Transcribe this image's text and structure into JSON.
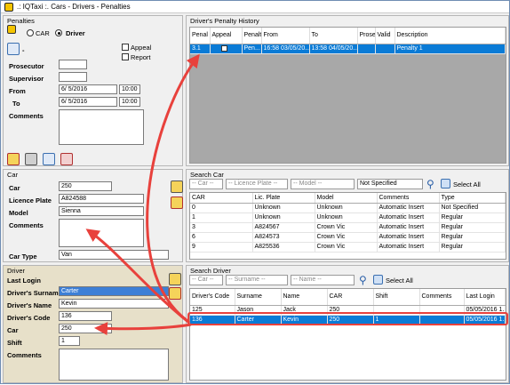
{
  "window": {
    "title": ".: IQTaxi :. Cars - Drivers - Penalties"
  },
  "penalties": {
    "group_title": "Penalties",
    "car_label": "CAR",
    "driver_label": "Driver",
    "appeal_label": "Appeal",
    "report_label": "Report",
    "prosecutor_label": "Prosecutor",
    "supervisor_label": "Supervisor",
    "from_label": "From",
    "to_label": "To",
    "from_date": "6/ 5/2016",
    "from_time": "10:00",
    "to_date": "6/ 5/2016",
    "to_time": "10:00",
    "comments_label": "Comments"
  },
  "car": {
    "group_title": "Car",
    "car_label": "Car",
    "car_value": "250",
    "plate_label": "Licence Plate",
    "plate_value": "A824588",
    "model_label": "Model",
    "model_value": "Sienna",
    "comments_label": "Comments",
    "type_label": "Car Type",
    "type_value": "Van"
  },
  "driver": {
    "group_title": "Driver",
    "last_login_label": "Last Login",
    "surname_label": "Driver's Surname",
    "surname_value": "Carter",
    "name_label": "Driver's Name",
    "name_value": "Kevin",
    "code_label": "Driver's Code",
    "code_value": "136",
    "car_label": "Car",
    "car_value": "250",
    "shift_label": "Shift",
    "shift_value": "1",
    "comments_label": "Comments"
  },
  "history": {
    "group_title": "Driver's Penalty History",
    "columns": [
      "Penal Code",
      "Appeal",
      "Penalt",
      "From",
      "To",
      "Prose",
      "Valid",
      "Description"
    ],
    "rows": [
      [
        "3.1",
        "",
        "Pen...",
        "16:58 03/05/20...",
        "13:58 04/05/20...",
        "",
        "",
        "Penalty 1"
      ]
    ]
  },
  "search_car": {
    "group_title": "Search Car",
    "filter_car": "-- Car --",
    "filter_plate": "-- Licence Plate --",
    "filter_model": "-- Model --",
    "filter_type": "Not Specified",
    "select_all": "Select All",
    "columns": [
      "CAR",
      "Lic. Plate",
      "Model",
      "Comments",
      "Type"
    ],
    "rows": [
      [
        "0",
        "Unknown",
        "Unknown",
        "Automatic Insert",
        "Not Specified"
      ],
      [
        "1",
        "Unknown",
        "Unknown",
        "Automatic Insert",
        "Regular"
      ],
      [
        "3",
        "A824567",
        "Crown Vic",
        "Automatic Insert",
        "Regular"
      ],
      [
        "6",
        "A824573",
        "Crown Vic",
        "Automatic Insert",
        "Regular"
      ],
      [
        "9",
        "A825536",
        "Crown Vic",
        "Automatic Insert",
        "Regular"
      ]
    ]
  },
  "search_driver": {
    "group_title": "Search Driver",
    "filter_car": "-- Car --",
    "filter_surname": "-- Surname --",
    "filter_name": "-- Name --",
    "select_all": "Select All",
    "columns": [
      "Driver's Code",
      "Surname",
      "Name",
      "CAR",
      "Shift",
      "Comments",
      "Last Login"
    ],
    "rows": [
      [
        "125",
        "Jason",
        "Jack",
        "250",
        "",
        "",
        "05/05/2016 1..."
      ],
      [
        "136",
        "Carter",
        "Kevin",
        "250",
        "1",
        "",
        "05/05/2016 1..."
      ]
    ]
  },
  "colors": {
    "selection": "#0a7bd6",
    "arrow": "#e8413c",
    "driver_panel": "#e7e0c9"
  }
}
